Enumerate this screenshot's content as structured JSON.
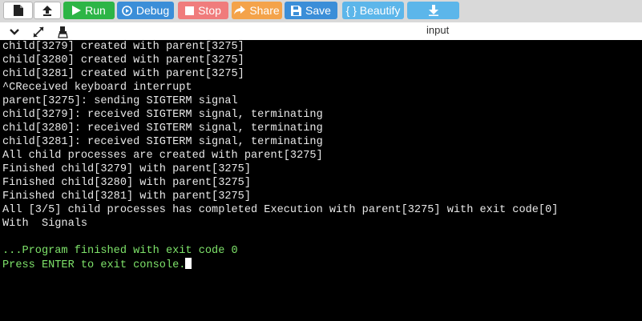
{
  "toolbar": {
    "run_label": "Run",
    "debug_label": "Debug",
    "stop_label": "Stop",
    "share_label": "Share",
    "save_label": "Save",
    "beautify_label": "{ } Beautify"
  },
  "io_panel": {
    "label": "input"
  },
  "console": {
    "lines": [
      "child[3279] created with parent[3275]",
      "child[3280] created with parent[3275]",
      "child[3281] created with parent[3275]",
      "^CReceived keyboard interrupt",
      "parent[3275]: sending SIGTERM signal",
      "child[3279]: received SIGTERM signal, terminating",
      "child[3280]: received SIGTERM signal, terminating",
      "child[3281]: received SIGTERM signal, terminating",
      "All child processes are created with parent[3275]",
      "Finished child[3279] with parent[3275]",
      "Finished child[3280] with parent[3275]",
      "Finished child[3281] with parent[3275]",
      "All [3/5] child processes has completed Execution with parent[3275] with exit code[0]",
      "With  Signals",
      "",
      "...Program finished with exit code 0",
      "Press ENTER to exit console."
    ],
    "finish_line_index": 15,
    "prompt_line_index": 16
  },
  "colors": {
    "run": "#2db546",
    "debug": "#3b8ed8",
    "stop": "#f07c7c",
    "share": "#f4a34a",
    "save": "#3b8ed8",
    "beautify": "#5cb6ea",
    "download": "#5cb6ea",
    "console_bg": "#000000",
    "console_text": "#e8e8e8",
    "status_text": "#7ee36a"
  },
  "icons": {
    "file": "file-icon",
    "upload": "upload-icon",
    "run": "play-icon",
    "debug": "debug-icon",
    "stop": "stop-icon",
    "share": "share-icon",
    "save": "save-icon",
    "download": "download-icon",
    "collapse": "chevron-down-icon",
    "expand": "expand-icon",
    "clear": "clear-console-icon"
  }
}
